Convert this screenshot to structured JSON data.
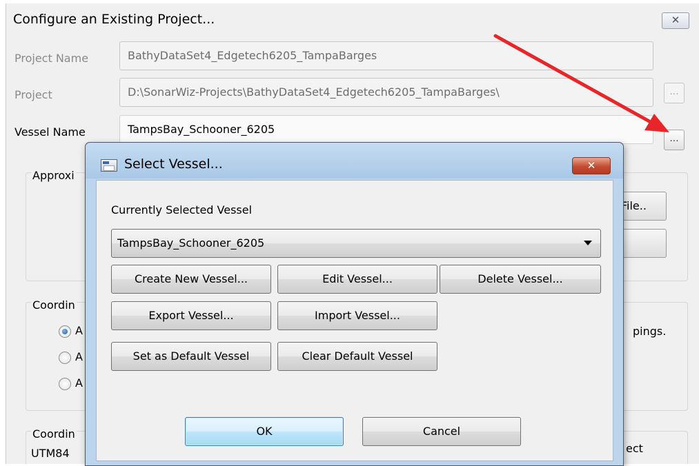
{
  "outer_window": {
    "title": "Configure an Existing Project...",
    "close_glyph": "✕",
    "project_name": {
      "label": "Project Name",
      "value": "BathyDataSet4_Edgetech6205_TampaBarges"
    },
    "project": {
      "label": "Project",
      "value": "D:\\SonarWiz-Projects\\BathyDataSet4_Edgetech6205_TampaBarges\\",
      "browse_label": "..."
    },
    "vessel_name": {
      "label": "Vessel Name",
      "value": "TampsBay_Schooner_6205",
      "browse_label": "..."
    },
    "group_approx": {
      "title": "Approxi",
      "button1_label": "File..",
      "button2_label": ""
    },
    "group_coords": {
      "title": "Coordin",
      "radio_labels": [
        "A",
        "A",
        "A"
      ],
      "selected_index": 0,
      "side_text": "pings."
    },
    "group_coords2": {
      "title": "Coordin",
      "value": "UTM84",
      "side_text": "ect"
    }
  },
  "dialog": {
    "title": "Select Vessel...",
    "close_glyph": "✕",
    "current_label": "Currently Selected Vessel",
    "selected_vessel": "TampsBay_Schooner_6205",
    "buttons": {
      "create": "Create New Vessel...",
      "edit": "Edit Vessel...",
      "delete": "Delete Vessel...",
      "export": "Export Vessel...",
      "import": "Import Vessel...",
      "set_default": "Set as Default Vessel",
      "clear_default": "Clear Default Vessel",
      "ok": "OK",
      "cancel": "Cancel"
    }
  },
  "colors": {
    "annotation_arrow": "#e8262a",
    "dialog_frame": "#bcd4ec",
    "close_button_red": "#c44c31"
  }
}
